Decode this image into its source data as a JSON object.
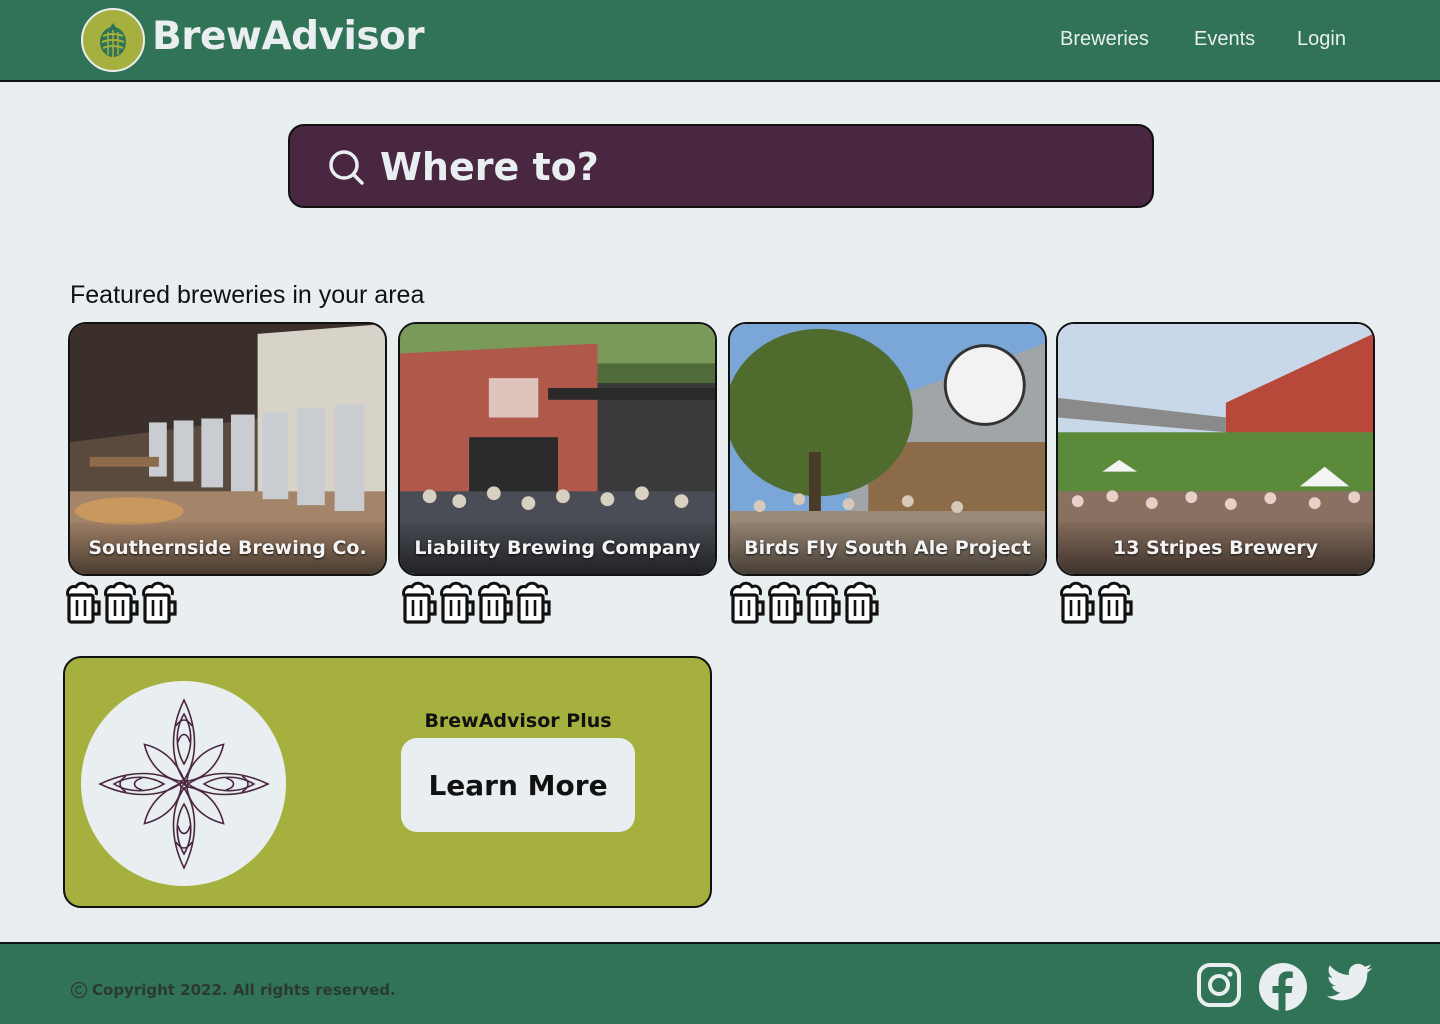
{
  "header": {
    "brand": "BrewAdvisor",
    "nav": [
      "Breweries",
      "Events",
      "Login"
    ]
  },
  "search": {
    "placeholder": "Where to?"
  },
  "featured": {
    "heading": "Featured breweries in your area",
    "cards": [
      {
        "name": "Southernside Brewing Co.",
        "rating": 3
      },
      {
        "name": "Liability Brewing Company",
        "rating": 4
      },
      {
        "name": "Birds Fly South Ale Project",
        "rating": 4
      },
      {
        "name": "13 Stripes Brewery",
        "rating": 2
      }
    ]
  },
  "promo": {
    "title": "BrewAdvisor Plus",
    "button": "Learn More"
  },
  "footer": {
    "copyright": "Copyright 2022. All rights reserved.",
    "social": [
      "instagram-icon",
      "facebook-icon",
      "twitter-icon"
    ]
  },
  "colors": {
    "header_bg": "#307356",
    "search_bg": "#4a2740",
    "promo_bg": "#a6b03e",
    "page_bg": "#e9eef1"
  }
}
